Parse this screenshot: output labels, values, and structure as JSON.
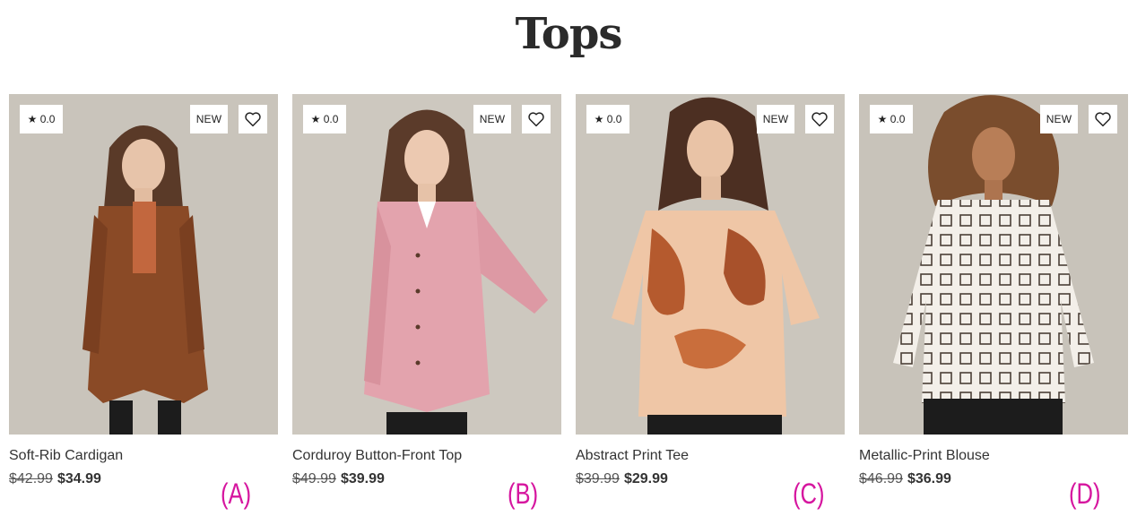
{
  "page": {
    "title": "Tops"
  },
  "colors": {
    "accent_label": "#d6169f",
    "image_bg": "#c9c4bb"
  },
  "products": [
    {
      "rating": "★ 0.0",
      "badge": "NEW",
      "wishlist_icon": "heart-outline-icon",
      "name": "Soft-Rib Cardigan",
      "old_price": "$42.99",
      "price": "$34.99",
      "label": "(A)"
    },
    {
      "rating": "★ 0.0",
      "badge": "NEW",
      "wishlist_icon": "heart-outline-icon",
      "name": "Corduroy Button-Front Top",
      "old_price": "$49.99",
      "price": "$39.99",
      "label": "(B)"
    },
    {
      "rating": "★ 0.0",
      "badge": "NEW",
      "wishlist_icon": "heart-outline-icon",
      "name": "Abstract Print Tee",
      "old_price": "$39.99",
      "price": "$29.99",
      "label": "(C)"
    },
    {
      "rating": "★ 0.0",
      "badge": "NEW",
      "wishlist_icon": "heart-outline-icon",
      "name": "Metallic-Print Blouse",
      "old_price": "$46.99",
      "price": "$36.99",
      "label": "(D)"
    }
  ]
}
